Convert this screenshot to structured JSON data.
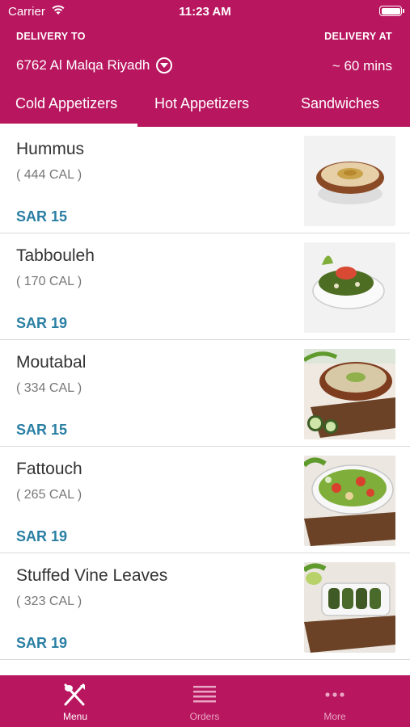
{
  "status": {
    "carrier": "Carrier",
    "time": "11:23 AM"
  },
  "header": {
    "delivery_to_label": "DELIVERY TO",
    "delivery_at_label": "DELIVERY AT",
    "address": "6762 Al Malqa Riyadh",
    "eta": "~ 60 mins"
  },
  "tabs": [
    {
      "label": "Cold Appetizers",
      "active": true
    },
    {
      "label": "Hot Appetizers",
      "active": false
    },
    {
      "label": "Sandwiches",
      "active": false
    }
  ],
  "items": [
    {
      "name": "Hummus",
      "cal": "( 444 CAL )",
      "price": "SAR 15",
      "image": "hummus-image"
    },
    {
      "name": "Tabbouleh",
      "cal": "( 170 CAL )",
      "price": "SAR 19",
      "image": "tabbouleh-image"
    },
    {
      "name": "Moutabal",
      "cal": "( 334 CAL )",
      "price": "SAR 15",
      "image": "moutabal-image"
    },
    {
      "name": "Fattouch",
      "cal": "( 265 CAL )",
      "price": "SAR 19",
      "image": "fattouch-image"
    },
    {
      "name": "Stuffed Vine Leaves",
      "cal": "( 323 CAL )",
      "price": "SAR 19",
      "image": "vine-leaves-image"
    }
  ],
  "tabbar": [
    {
      "label": "Menu",
      "icon": "fork-knife-icon",
      "active": true
    },
    {
      "label": "Orders",
      "icon": "list-icon",
      "active": false
    },
    {
      "label": "More",
      "icon": "more-dots-icon",
      "active": false
    }
  ],
  "colors": {
    "brand": "#b8165f",
    "price": "#2a7fa4"
  }
}
